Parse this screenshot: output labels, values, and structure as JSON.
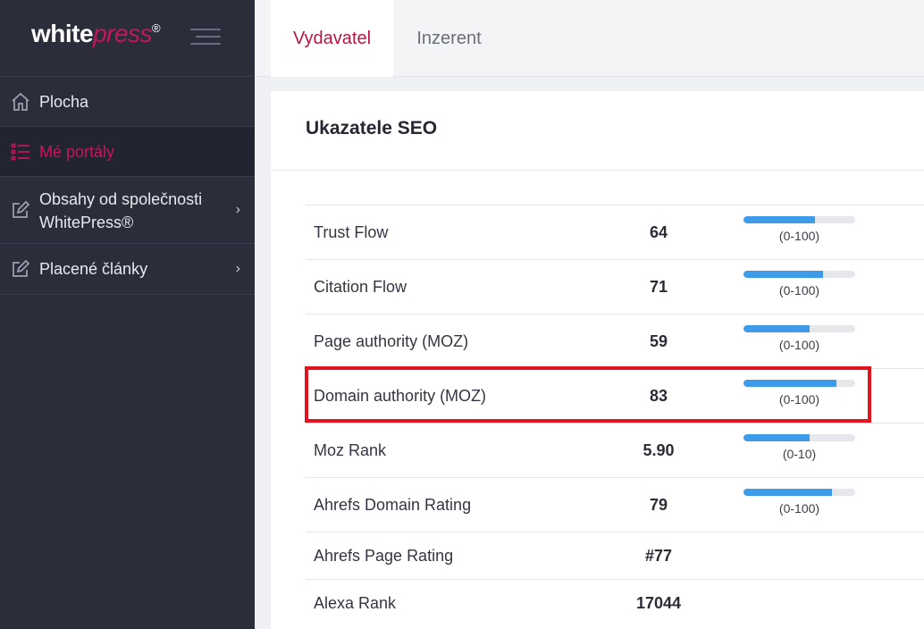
{
  "logo": {
    "white": "white",
    "press": "press",
    "reg": "®"
  },
  "sidebar": {
    "items": [
      {
        "label": "Plocha"
      },
      {
        "label": "Mé portály"
      },
      {
        "label": "Obsahy od společnosti WhitePress®",
        "line1": "Obsahy od společnosti",
        "line2": "WhitePress®"
      },
      {
        "label": "Placené články"
      }
    ]
  },
  "tabs": [
    {
      "label": "Vydavatel",
      "active": true
    },
    {
      "label": "Inzerent",
      "active": false
    }
  ],
  "card": {
    "title": "Ukazatele SEO"
  },
  "seo": [
    {
      "name": "Trust Flow",
      "value": "64",
      "range": "(0-100)",
      "fill": 0.64
    },
    {
      "name": "Citation Flow",
      "value": "71",
      "range": "(0-100)",
      "fill": 0.71
    },
    {
      "name": "Page authority (MOZ)",
      "value": "59",
      "range": "(0-100)",
      "fill": 0.59
    },
    {
      "name": "Domain authority (MOZ)",
      "value": "83",
      "range": "(0-100)",
      "fill": 0.83
    },
    {
      "name": "Moz Rank",
      "value": "5.90",
      "range": "(0-10)",
      "fill": 0.59
    },
    {
      "name": "Ahrefs Domain Rating",
      "value": "79",
      "range": "(0-100)",
      "fill": 0.79
    },
    {
      "name": "Ahrefs Page Rating",
      "value": "#77"
    },
    {
      "name": "Alexa Rank",
      "value": "17044"
    }
  ],
  "colors": {
    "accent": "#c2185b",
    "bar": "#3d9be9",
    "highlight": "#e2141f",
    "sidebar": "#2b2d3b"
  }
}
